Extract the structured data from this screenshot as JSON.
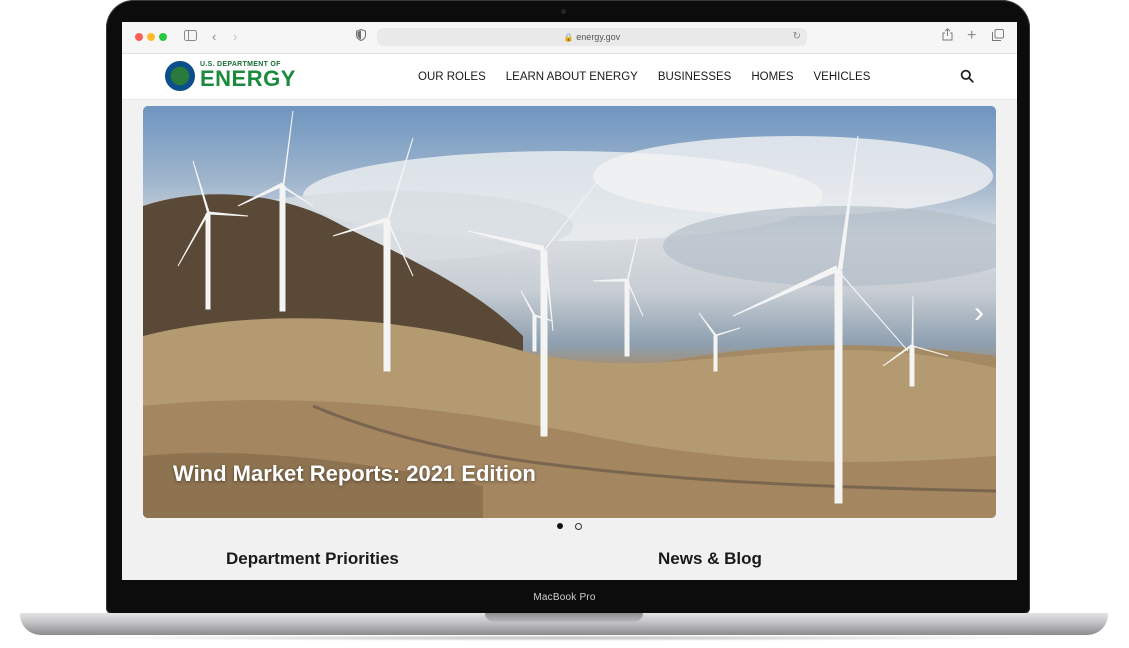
{
  "browser": {
    "url": "energy.gov"
  },
  "site": {
    "logo_small": "U.S. DEPARTMENT OF",
    "logo_big": "ENERGY",
    "nav": [
      {
        "label": "OUR ROLES"
      },
      {
        "label": "LEARN ABOUT ENERGY"
      },
      {
        "label": "BUSINESSES"
      },
      {
        "label": "HOMES"
      },
      {
        "label": "VEHICLES"
      }
    ]
  },
  "hero": {
    "caption": "Wind Market Reports: 2021 Edition",
    "slides_total": 2,
    "active_slide": 1
  },
  "sections": {
    "left_title": "Department Priorities",
    "right_title": "News & Blog"
  },
  "device": {
    "model": "MacBook Pro"
  },
  "colors": {
    "brand_green": "#1b8a3c",
    "close": "#fe5f57",
    "minimize": "#febc2e",
    "zoom": "#28c840"
  }
}
